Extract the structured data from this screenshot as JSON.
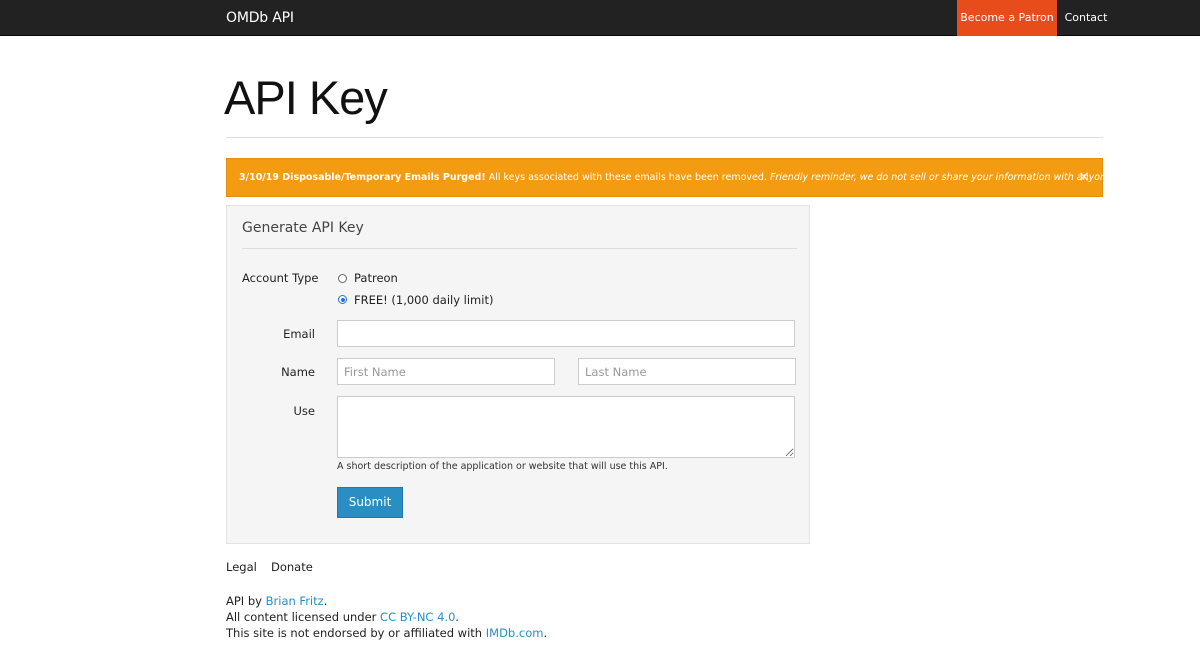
{
  "navbar": {
    "brand": "OMDb API",
    "patron_label": "Become a Patron",
    "contact_label": "Contact"
  },
  "page": {
    "title": "API Key"
  },
  "alert": {
    "bold_text": "3/10/19 Disposable/Temporary Emails Purged!",
    "plain_text": " All keys associated with these emails have been removed. ",
    "italic_text": "Friendly reminder, we do not sell or share your information with anyone else.",
    "close_glyph": "×",
    "color": "#f39c12"
  },
  "form": {
    "panel_title": "Generate API Key",
    "account_type_label": "Account Type",
    "account_options": [
      {
        "label": "Patreon",
        "selected": false
      },
      {
        "label": "FREE! (1,000 daily limit)",
        "selected": true
      }
    ],
    "email_label": "Email",
    "email_value": "",
    "name_label": "Name",
    "first_name_placeholder": "First Name",
    "last_name_placeholder": "Last Name",
    "use_label": "Use",
    "use_value": "",
    "use_help": "A short description of the application or website that will use this API.",
    "submit_label": "Submit",
    "submit_color": "#2a8ec4"
  },
  "footer": {
    "links": [
      "Legal",
      "Donate"
    ],
    "credit_prefix": "API by ",
    "credit_author": "Brian Fritz",
    "credit_suffix": ".",
    "license_prefix": "All content licensed under ",
    "license_link": "CC BY-NC 4.0",
    "license_suffix": ".",
    "disclaimer_prefix": "This site is not endorsed by or affiliated with ",
    "disclaimer_link": "IMDb.com",
    "disclaimer_suffix": "."
  },
  "colors": {
    "navbar_bg": "#222222",
    "patron_bg": "#e84c1a",
    "link": "#2a8ec4"
  }
}
